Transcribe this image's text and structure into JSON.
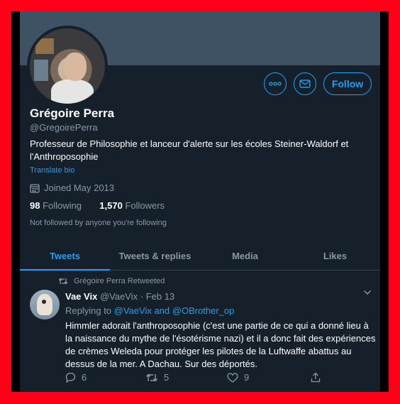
{
  "profile": {
    "name": "Grégoire Perra",
    "handle": "@GregoirePerra",
    "bio": "Professeur de Philosophie et lanceur d'alerte sur les écoles Steiner-Waldorf et l'Anthroposophie",
    "translate_label": "Translate bio",
    "joined": "Joined May 2013",
    "following_count": "98",
    "following_label": "Following",
    "followers_count": "1,570",
    "followers_label": "Followers",
    "not_followed_text": "Not followed by anyone you're following",
    "follow_label": "Follow"
  },
  "tabs": [
    {
      "label": "Tweets"
    },
    {
      "label": "Tweets & replies"
    },
    {
      "label": "Media"
    },
    {
      "label": "Likes"
    }
  ],
  "tweet": {
    "retweet_note": "Grégoire Perra Retweeted",
    "author_name": "Vae Vix",
    "author_handle": "@VaeVix",
    "separator": " · ",
    "date": "Feb 13",
    "replying_prefix": "Replying to ",
    "reply_to_1": "@VaeVix",
    "reply_and": " and ",
    "reply_to_2": "@OBrother_op",
    "text": "Himmler adorait l'anthroposophie (c'est une partie de ce qui a donné lieu à la naissance du mythe de l'ésotérisme nazi) et il a donc fait des expériences de crèmes Weleda pour protéger les pilotes de la Luftwaffe abattus au dessus de la mer. A Dachau. Sur des déportés.",
    "reply_count": "6",
    "retweet_count": "5",
    "like_count": "9"
  },
  "colors": {
    "accent": "#1da1f2",
    "background": "#15202b",
    "banner": "#3f5264",
    "border": "#ff0018"
  },
  "icons": [
    "more-icon",
    "mail-icon",
    "calendar-icon",
    "retweet-icon",
    "chevron-down-icon",
    "reply-icon",
    "like-icon",
    "share-icon"
  ]
}
